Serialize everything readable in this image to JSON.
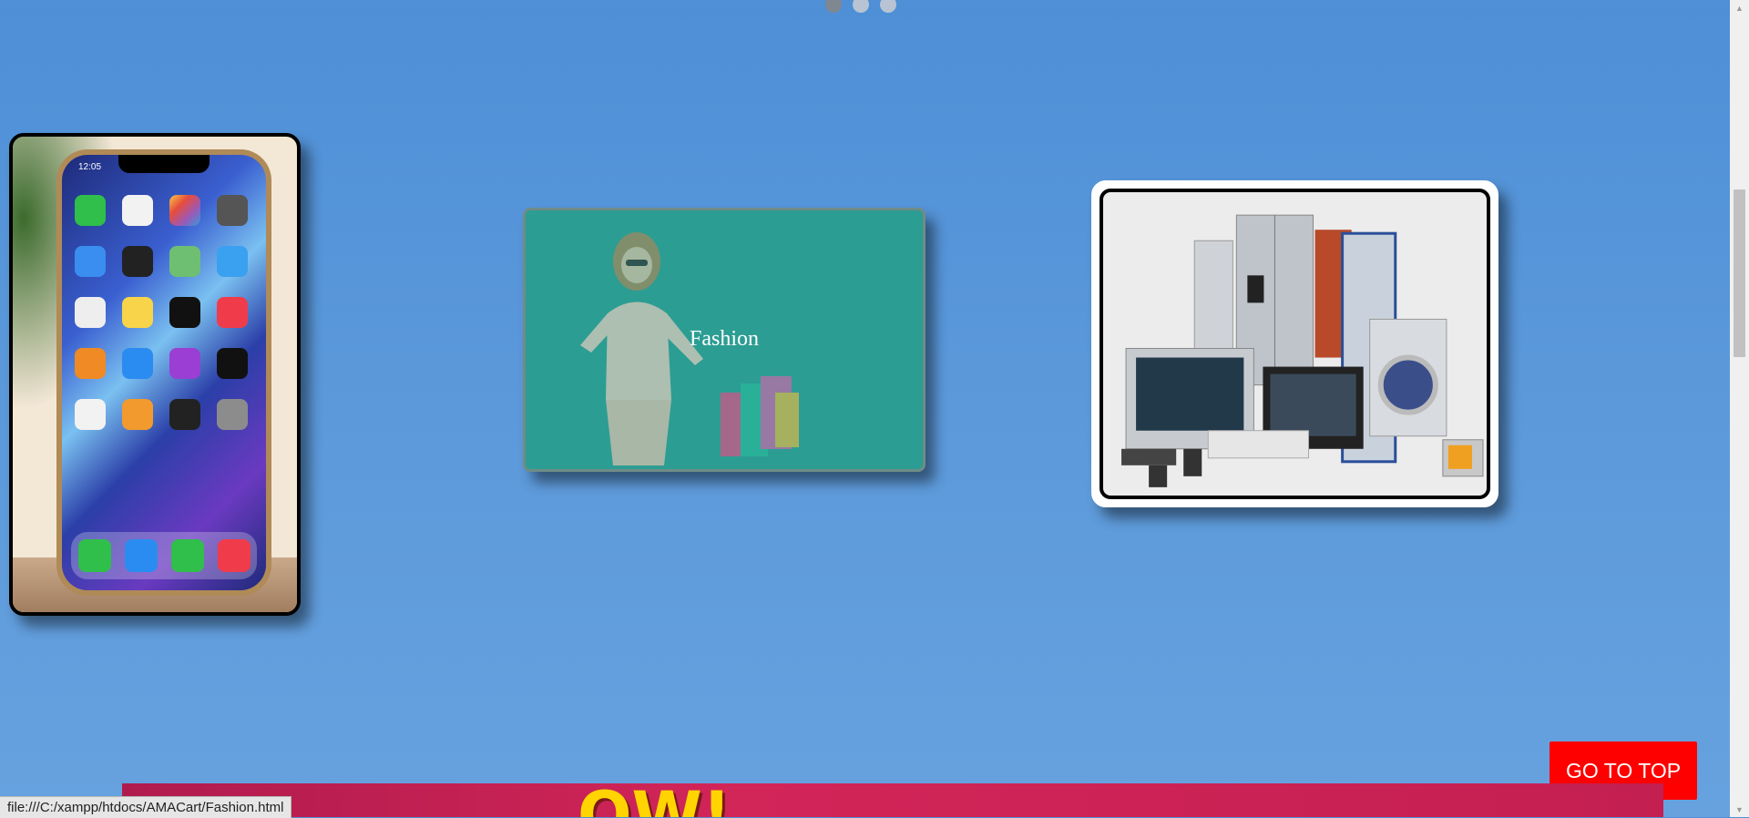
{
  "carousel": {
    "dots": [
      {
        "active": true
      },
      {
        "active": false
      },
      {
        "active": false
      }
    ]
  },
  "categories": [
    {
      "id": "mobiles",
      "image": "smartphone-photo",
      "caption": ""
    },
    {
      "id": "fashion",
      "image": "woman-with-shopping-bags-photo",
      "caption": "Fashion"
    },
    {
      "id": "electronics",
      "image": "home-appliances-photo",
      "caption": ""
    }
  ],
  "phone_screen": {
    "time": "12:05"
  },
  "go_top": {
    "label": "GO TO TOP"
  },
  "banner": {
    "text": "OW!"
  },
  "status_bar": {
    "url": "file:///C:/xampp/htdocs/AMACart/Fashion.html"
  },
  "colors": {
    "background": "#5a98da",
    "go_top": "#ff0000",
    "banner": "#c41f51"
  }
}
